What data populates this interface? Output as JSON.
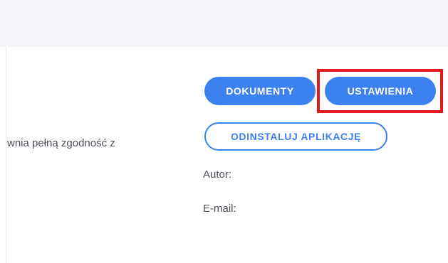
{
  "description": {
    "text": "wnia pełną zgodność z"
  },
  "actions": {
    "documents_label": "DOKUMENTY",
    "settings_label": "USTAWIENIA",
    "uninstall_label": "ODINSTALUJ APLIKACJĘ"
  },
  "meta": {
    "author_label": "Autor:",
    "email_label": "E-mail:"
  },
  "colors": {
    "primary": "#3b82f0",
    "highlight": "#e11b22",
    "top_bar": "#f3f5f8",
    "text": "#4a4f57"
  }
}
